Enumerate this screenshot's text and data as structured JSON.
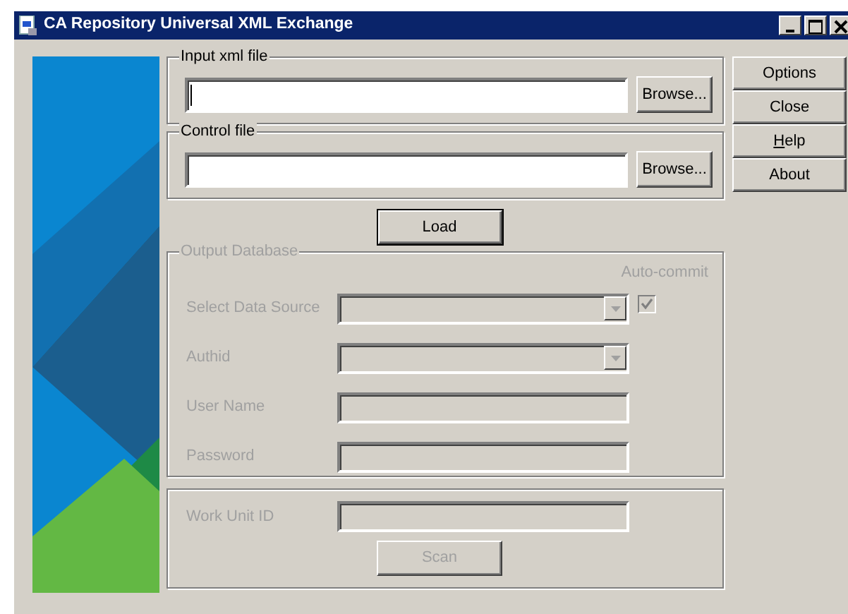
{
  "window": {
    "title": "CA Repository Universal XML Exchange"
  },
  "file_groups": [
    {
      "label": "Input xml file",
      "button": "Browse...",
      "focused": true
    },
    {
      "label": "Control file",
      "button": "Browse...",
      "focused": false
    }
  ],
  "load_button": "Load",
  "output_database": {
    "label": "Output Database",
    "disabled": true,
    "auto_commit": {
      "label": "Auto-commit",
      "checked": true,
      "disabled": true
    },
    "fields": [
      {
        "kind": "dropdown",
        "label": "Select Data Source",
        "disabled": true
      },
      {
        "kind": "dropdown",
        "label": "Authid",
        "disabled": true
      },
      {
        "kind": "text",
        "label": "User Name",
        "disabled": true
      },
      {
        "kind": "text",
        "label": "Password",
        "disabled": true
      }
    ]
  },
  "work_unit": {
    "fields": [
      {
        "kind": "text",
        "label": "Work Unit ID",
        "disabled": true
      }
    ],
    "button": {
      "label": "Scan",
      "disabled": true
    }
  },
  "side_buttons": [
    {
      "label": "Options",
      "access_key": false
    },
    {
      "label": "Close",
      "access_key": false
    },
    {
      "label": "Help",
      "access_key": true
    },
    {
      "label": "About",
      "access_key": false
    }
  ]
}
